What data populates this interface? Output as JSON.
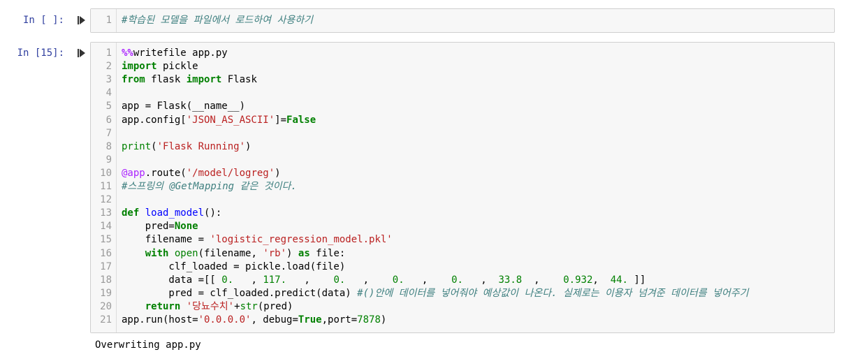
{
  "cell1": {
    "prompt": "In [ ]:",
    "lines": [
      {
        "n": "1",
        "tokens": [
          {
            "t": "#학습된 모델을 파일에서 로드하여 사용하기",
            "c": "cm"
          }
        ]
      }
    ]
  },
  "cell2": {
    "prompt": "In [15]:",
    "lines": [
      {
        "n": "1",
        "tokens": [
          {
            "t": "%%",
            "c": "mg"
          },
          {
            "t": "writefile app.py",
            "c": ""
          }
        ]
      },
      {
        "n": "2",
        "tokens": [
          {
            "t": "import",
            "c": "kw"
          },
          {
            "t": " pickle",
            "c": ""
          }
        ]
      },
      {
        "n": "3",
        "tokens": [
          {
            "t": "from",
            "c": "kw"
          },
          {
            "t": " flask ",
            "c": ""
          },
          {
            "t": "import",
            "c": "kw"
          },
          {
            "t": " Flask",
            "c": ""
          }
        ]
      },
      {
        "n": "4",
        "tokens": []
      },
      {
        "n": "5",
        "tokens": [
          {
            "t": "app = Flask(__name__)",
            "c": ""
          }
        ]
      },
      {
        "n": "6",
        "tokens": [
          {
            "t": "app.config[",
            "c": ""
          },
          {
            "t": "'JSON_AS_ASCII'",
            "c": "str"
          },
          {
            "t": "]=",
            "c": ""
          },
          {
            "t": "False",
            "c": "kw"
          }
        ]
      },
      {
        "n": "7",
        "tokens": []
      },
      {
        "n": "8",
        "tokens": [
          {
            "t": "print",
            "c": "bi"
          },
          {
            "t": "(",
            "c": ""
          },
          {
            "t": "'Flask Running'",
            "c": "str"
          },
          {
            "t": ")",
            "c": ""
          }
        ]
      },
      {
        "n": "9",
        "tokens": []
      },
      {
        "n": "10",
        "tokens": [
          {
            "t": "@app",
            "c": "dec"
          },
          {
            "t": ".route(",
            "c": ""
          },
          {
            "t": "'/model/logreg'",
            "c": "str"
          },
          {
            "t": ")",
            "c": ""
          }
        ]
      },
      {
        "n": "11",
        "tokens": [
          {
            "t": "#스프링의 @GetMapping 같은 것이다.",
            "c": "cm"
          }
        ]
      },
      {
        "n": "12",
        "tokens": []
      },
      {
        "n": "13",
        "tokens": [
          {
            "t": "def",
            "c": "kw"
          },
          {
            "t": " ",
            "c": ""
          },
          {
            "t": "load_model",
            "c": "fn"
          },
          {
            "t": "():",
            "c": ""
          }
        ]
      },
      {
        "n": "14",
        "tokens": [
          {
            "t": "    pred=",
            "c": ""
          },
          {
            "t": "None",
            "c": "kw"
          }
        ]
      },
      {
        "n": "15",
        "tokens": [
          {
            "t": "    filename = ",
            "c": ""
          },
          {
            "t": "'logistic_regression_model.pkl'",
            "c": "str"
          }
        ]
      },
      {
        "n": "16",
        "tokens": [
          {
            "t": "    ",
            "c": ""
          },
          {
            "t": "with",
            "c": "kw"
          },
          {
            "t": " ",
            "c": ""
          },
          {
            "t": "open",
            "c": "bi"
          },
          {
            "t": "(filename, ",
            "c": ""
          },
          {
            "t": "'rb'",
            "c": "str"
          },
          {
            "t": ") ",
            "c": ""
          },
          {
            "t": "as",
            "c": "kw"
          },
          {
            "t": " file:",
            "c": ""
          }
        ]
      },
      {
        "n": "17",
        "tokens": [
          {
            "t": "        clf_loaded = pickle.load(file)",
            "c": ""
          }
        ]
      },
      {
        "n": "18",
        "tokens": [
          {
            "t": "        data =[[ ",
            "c": ""
          },
          {
            "t": "0.",
            "c": "num"
          },
          {
            "t": "   , ",
            "c": ""
          },
          {
            "t": "117.",
            "c": "num"
          },
          {
            "t": "   ,    ",
            "c": ""
          },
          {
            "t": "0.",
            "c": "num"
          },
          {
            "t": "   ,    ",
            "c": ""
          },
          {
            "t": "0.",
            "c": "num"
          },
          {
            "t": "   ,    ",
            "c": ""
          },
          {
            "t": "0.",
            "c": "num"
          },
          {
            "t": "   ,  ",
            "c": ""
          },
          {
            "t": "33.8",
            "c": "num"
          },
          {
            "t": "  ,    ",
            "c": ""
          },
          {
            "t": "0.932",
            "c": "num"
          },
          {
            "t": ",  ",
            "c": ""
          },
          {
            "t": "44.",
            "c": "num"
          },
          {
            "t": " ]]",
            "c": ""
          }
        ]
      },
      {
        "n": "19",
        "tokens": [
          {
            "t": "        pred = clf_loaded.predict(data) ",
            "c": ""
          },
          {
            "t": "#()안에 데이터를 넣어줘야 예상값이 나온다. 실제로는 이용자 넘겨준 데이터를 넣어주기",
            "c": "cm"
          }
        ]
      },
      {
        "n": "20",
        "tokens": [
          {
            "t": "    ",
            "c": ""
          },
          {
            "t": "return",
            "c": "kw"
          },
          {
            "t": " ",
            "c": ""
          },
          {
            "t": "'당뇨수치'",
            "c": "str"
          },
          {
            "t": "+",
            "c": ""
          },
          {
            "t": "str",
            "c": "bi"
          },
          {
            "t": "(pred)",
            "c": ""
          }
        ]
      },
      {
        "n": "21",
        "tokens": [
          {
            "t": "app.run(host=",
            "c": ""
          },
          {
            "t": "'0.0.0.0'",
            "c": "str"
          },
          {
            "t": ", debug=",
            "c": ""
          },
          {
            "t": "True",
            "c": "kw"
          },
          {
            "t": ",port=",
            "c": ""
          },
          {
            "t": "7878",
            "c": "num"
          },
          {
            "t": ")",
            "c": ""
          }
        ]
      }
    ]
  },
  "output": {
    "text": "Overwriting app.py"
  }
}
